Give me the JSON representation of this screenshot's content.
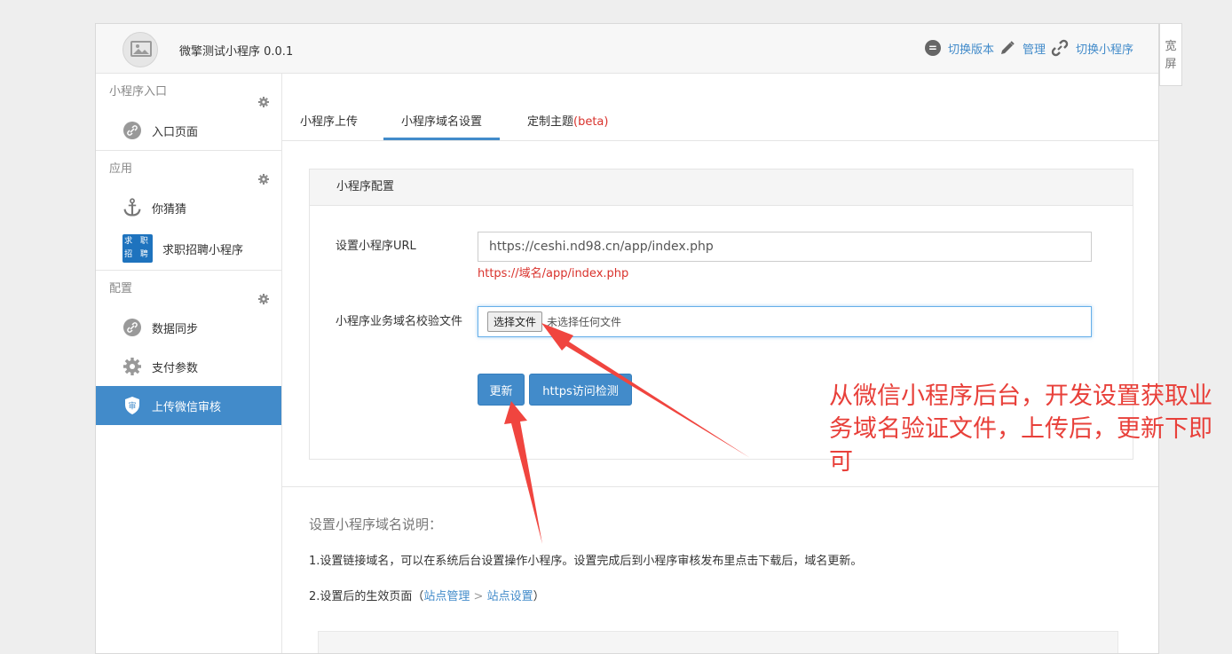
{
  "header": {
    "app_title": "微擎测试小程序 0.0.1",
    "switch_version": "切换版本",
    "manage": "管理",
    "switch_app": "切换小程序",
    "wide_screen": "宽屏"
  },
  "sidebar": {
    "groups": [
      {
        "title": "小程序入口",
        "items": [
          {
            "label": "入口页面",
            "icon": "link-icon"
          }
        ]
      },
      {
        "title": "应用",
        "items": [
          {
            "label": "你猜猜",
            "icon": "anchor-icon"
          },
          {
            "label": "求职招聘小程序",
            "icon": "recruit-app-icon",
            "icon_text": "求 职 招 聘"
          }
        ]
      },
      {
        "title": "配置",
        "items": [
          {
            "label": "数据同步",
            "icon": "link-icon"
          },
          {
            "label": "支付参数",
            "icon": "gear-icon"
          },
          {
            "label": "上传微信审核",
            "icon": "shield-icon",
            "active": true,
            "icon_text": "审"
          }
        ]
      }
    ]
  },
  "tabs": [
    {
      "label": "小程序上传"
    },
    {
      "label": "小程序域名设置",
      "active": true
    },
    {
      "label": "定制主题",
      "suffix": "(beta)"
    }
  ],
  "panel": {
    "title": "小程序配置",
    "url_label": "设置小程序URL",
    "url_value": "https://ceshi.nd98.cn/app/index.php",
    "url_hint": "https://域名/app/index.php",
    "file_label": "小程序业务域名校验文件",
    "file_button": "选择文件",
    "file_none": "未选择任何文件",
    "update_button": "更新",
    "https_check_button": "https访问检测"
  },
  "notes": {
    "title": "设置小程序域名说明：",
    "line1": "1.设置链接域名，可以在系统后台设置操作小程序。设置完成后到小程序审核发布里点击下载后，域名更新。",
    "line2_prefix": "2.设置后的生效页面（",
    "link1": "站点管理",
    "sep": " > ",
    "link2": "站点设置",
    "line2_suffix": "）"
  },
  "annotation": {
    "text": "从微信小程序后台，开发设置获取业务域名验证文件，上传后，更新下即可"
  },
  "colors": {
    "accent": "#428bca",
    "danger": "#d9322c",
    "annotation": "#e8403a"
  }
}
